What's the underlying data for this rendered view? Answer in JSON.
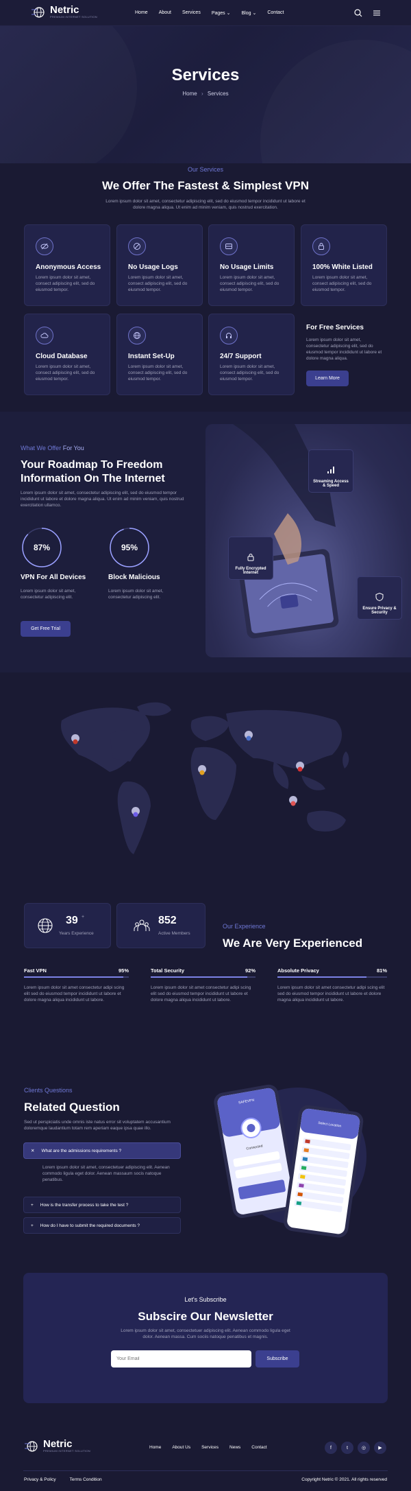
{
  "brand": {
    "name": "Netric",
    "tagline": "PREMIUM INTERNET SOLUTION"
  },
  "nav": {
    "items": [
      "Home",
      "About",
      "Services",
      "Pages",
      "Blog",
      "Contact"
    ]
  },
  "hero": {
    "title": "Services",
    "crumb_home": "Home",
    "crumb_sep": "›",
    "crumb_current": "Services"
  },
  "services": {
    "eyebrow": "Our Services",
    "title": "We Offer The Fastest & Simplest VPN",
    "lead": "Lorem ipsum dolor sit amet, consectetur adipiscing elit, sed do eiusmod tempor incididunt ut labore et dolore magna aliqua. Ut enim ad minim veniam, quis nostrud exercitation.",
    "cards": [
      {
        "title": "Anonymous Access",
        "text": "Lorem ipsum dolor sit amet, consect adipiscing elit, sed do eiusmod tempor.",
        "icon": "eye-off-icon"
      },
      {
        "title": "No Usage Logs",
        "text": "Lorem ipsum dolor sit amet, consect adipiscing elit, sed do eiusmod tempor.",
        "icon": "ban-icon"
      },
      {
        "title": "No Usage Limits",
        "text": "Lorem ipsum dolor sit amet, consect adipiscing elit, sed do eiusmod tempor.",
        "icon": "inbox-icon"
      },
      {
        "title": "100% White Listed",
        "text": "Lorem ipsum dolor sit amet, consect adipiscing elit, sed do eiusmod tempor.",
        "icon": "lock-icon"
      },
      {
        "title": "Cloud Database",
        "text": "Lorem ipsum dolor sit amet, consect adipiscing elit, sed do eiusmod tempor.",
        "icon": "cloud-icon"
      },
      {
        "title": "Instant Set-Up",
        "text": "Lorem ipsum dolor sit amet, consect adipiscing elit, sed do eiusmod tempor.",
        "icon": "globe-icon"
      },
      {
        "title": "24/7 Support",
        "text": "Lorem ipsum dolor sit amet, consect adipiscing elit, sed do eiusmod tempor.",
        "icon": "headset-icon"
      }
    ],
    "free": {
      "title": "For Free Services",
      "text": "Lorem ipsum dolor sit amet, consectetur adipiscing elit, sed do eiusmod tempor incididunt ut labore et dolore magna aliqua.",
      "button": "Learn More"
    }
  },
  "roadmap": {
    "eyebrow_a": "What We Offer",
    "eyebrow_b": "For You",
    "title_l1": "Your Roadmap To Freedom",
    "title_l2": "Information On The Internet",
    "lead": "Lorem ipsum dolor sit amet, consectetur adipiscing elit, sed do eiusmod tempor incididunt ut labore et dolore magna aliqua. Ut enim ad minim veniam, quis nostrud exercitation ullamco.",
    "stats": [
      {
        "percent": "87%",
        "value": 0.87,
        "title": "VPN For All Devices",
        "text": "Lorem ipsum dolor sit amet, consectetur adipiscing elit."
      },
      {
        "percent": "95%",
        "value": 0.95,
        "title": "Block Malicious",
        "text": "Lorem ipsum dolor sit amet, consectetur adipiscing elit."
      }
    ],
    "button": "Get Free Trial",
    "badges": {
      "streaming": "Streaming Access & Speed",
      "encrypted": "Fully Encrypted Internet",
      "privacy": "Ensure Privacy & Security"
    }
  },
  "experience": {
    "years": "39",
    "years_sup": "+",
    "years_label": "Years Experience",
    "members": "852",
    "members_label": "Active Members",
    "eyebrow": "Our Experience",
    "title": "We Are Very Experienced",
    "bars": [
      {
        "label": "Fast VPN",
        "percent": "95%",
        "value": 0.95,
        "text": "Lorem ipsum dolor sit amet consectetur adipi scing elit sed do eiusmod tempor incididunt ut labore et dolore magna aliqua incididunt ut labore."
      },
      {
        "label": "Total Security",
        "percent": "92%",
        "value": 0.92,
        "text": "Lorem ipsum dolor sit amet consectetur adipi scing elit sed do eiusmod tempor incididunt ut labore et dolore magna aliqua incididunt ut labore."
      },
      {
        "label": "Absolute Privacy",
        "percent": "81%",
        "value": 0.81,
        "text": "Lorem ipsum dolor sit amet consectetur adipi scing elit sed do eiusmod tempor incididunt ut labore et dolore magna aliqua incididunt ut labore."
      }
    ]
  },
  "faq": {
    "eyebrow": "Clients Questions",
    "title": "Related Question",
    "lead": "Sed ut perspiciatis unde omnis iste natus error sit voluptatem accusantium doloremque laudantium totam rem aperiam eaque ipsa quae illo.",
    "items": [
      {
        "q": "What are the admissions requirements ?",
        "open": true,
        "icon": "✕"
      },
      {
        "q": "How is the transfer process to take the test ?",
        "open": false,
        "icon": "+"
      },
      {
        "q": "How do I have to submit the required documents ?",
        "open": false,
        "icon": "+"
      }
    ],
    "answer": "Lorem ipsum dolor sit amet, consectetuer adipiscing elit. Aenean commodo ligula eget dolor. Aenean massaum socis natoque penatibus."
  },
  "phone": {
    "app_name": "SAFEVPN",
    "status": "Connected",
    "location_label": "Select Location"
  },
  "newsletter": {
    "eyebrow": "Let's Subscribe",
    "title": "Subscire Our Newsletter",
    "text": "Lorem ipsum dolor sit amet, consectetuer adipiscing elit. Aenean commodo ligula eget dolor. Aenean massa. Cum sociis natoque penatibus et magnis.",
    "placeholder": "Your Email",
    "button": "Subscribe"
  },
  "footer": {
    "links": [
      "Home",
      "About Us",
      "Services",
      "News",
      "Contact"
    ],
    "privacy": "Privacy & Policy",
    "terms": "Terms Condition",
    "copyright": "Copyright Netric © 2021. All rights reserved",
    "social": [
      "facebook-icon",
      "twitter-icon",
      "instagram-icon",
      "youtube-icon"
    ]
  },
  "colors": {
    "background": "#1a1a33",
    "accent": "#6f78d6",
    "card": "#22234a",
    "button": "#3b3f8f"
  }
}
